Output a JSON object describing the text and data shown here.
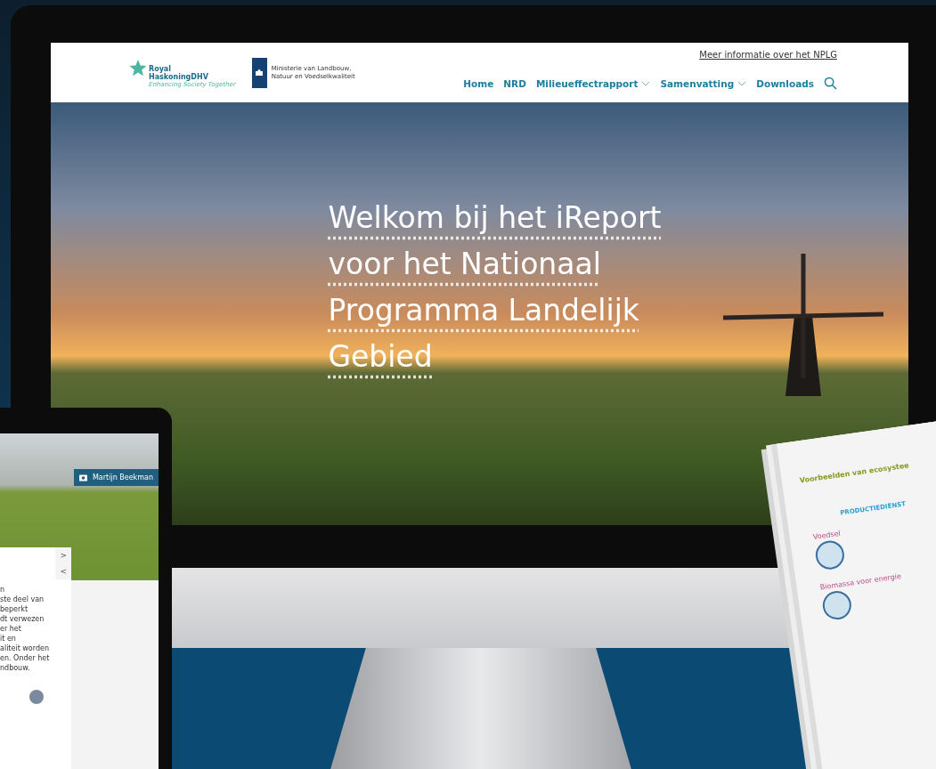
{
  "monitor": {
    "header": {
      "brand_logo": {
        "name_lines": [
          "Royal",
          "HaskoningDHV"
        ],
        "tagline": "Enhancing Society Together"
      },
      "ministry_logo": {
        "name_lines": [
          "Ministerie van Landbouw,",
          "Natuur en Voedselkwaliteit"
        ]
      },
      "top_link": "Meer informatie over het NPLG",
      "nav": [
        {
          "label": "Home",
          "kind": "link"
        },
        {
          "label": "NRD",
          "kind": "link"
        },
        {
          "label": "Milieueffectrapport",
          "kind": "dropdown"
        },
        {
          "label": "Samenvatting",
          "kind": "dropdown"
        },
        {
          "label": "Downloads",
          "kind": "link"
        }
      ]
    },
    "hero": {
      "title": "Welkom bij het iReport voor het Nationaal Programma Landelijk Gebied"
    }
  },
  "tablet": {
    "photo_credit": "Martijn Beekman",
    "next": ">",
    "previous": "<",
    "text_lines": [
      "n",
      "ste deel van",
      "beperkt",
      "dt verwezen",
      "er het",
      "it en",
      "aliteit worden",
      "en. Onder het",
      "ndbouw."
    ]
  },
  "brochure": {
    "title": "Voorbeelden van ecosystee",
    "section": "PRODUCTIEDIENST",
    "labels": [
      "Voedsel",
      "Biomassa voor energie"
    ]
  }
}
